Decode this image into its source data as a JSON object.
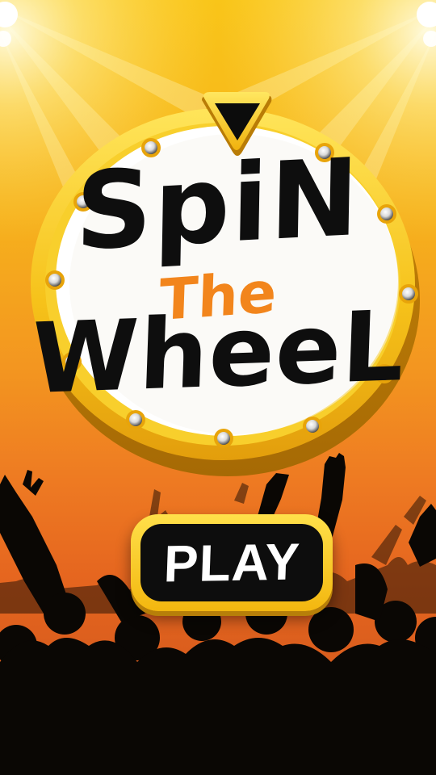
{
  "screen": {
    "name": "spin-the-wheel-title-screen"
  },
  "title": {
    "line1": "SpiN",
    "line2": "The",
    "line3": "WheeL"
  },
  "play_button": {
    "label": "PLAY"
  },
  "colors": {
    "background_top": "#f9c519",
    "background_bottom": "#e5651f",
    "wheel_rim": "#f6c21a",
    "wheel_face": "#ffffff",
    "pointer": "#f7c417",
    "title_black": "#0e0e0e",
    "title_orange": "#f2851c",
    "crowd": "#0a0704"
  },
  "icons": {
    "pointer": "triangle-pointer-icon",
    "bulbs": "light-bulb-icon",
    "spotlights": "stage-spotlight-icon"
  }
}
